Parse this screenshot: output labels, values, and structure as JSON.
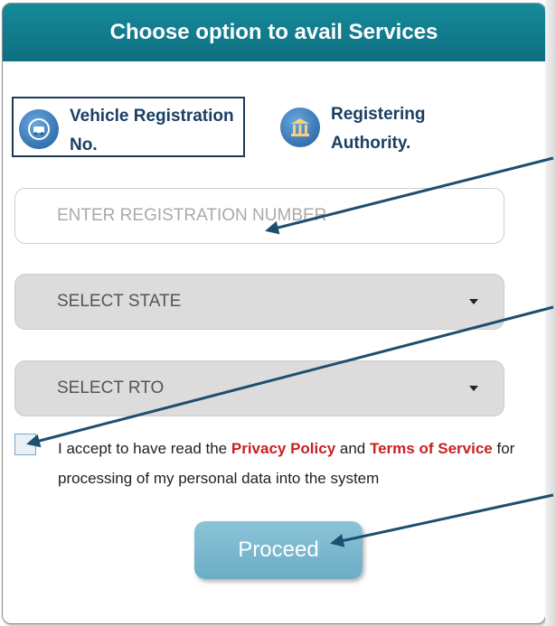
{
  "header": {
    "title": "Choose option to avail Services"
  },
  "options": [
    {
      "label": "Vehicle Registration\nNo.",
      "icon": "car-icon",
      "selected": true
    },
    {
      "label": "Registering\nAuthority.",
      "icon": "authority-icon",
      "selected": false
    }
  ],
  "registration": {
    "placeholder": "ENTER REGISTRATION NUMBER"
  },
  "state_select": {
    "selected": "SELECT STATE"
  },
  "rto_select": {
    "selected": "SELECT RTO"
  },
  "consent": {
    "checked": false,
    "prefix": "I accept to have read the ",
    "privacy_link": "Privacy Policy",
    "and": " and ",
    "terms_link": "Terms of Service",
    "suffix": " for processing of my personal data into the system"
  },
  "proceed_label": "Proceed",
  "colors": {
    "header": "#117b8c",
    "link": "#cc1f1f",
    "button": "#7ab8cf",
    "arrow": "#1d4f6e"
  }
}
